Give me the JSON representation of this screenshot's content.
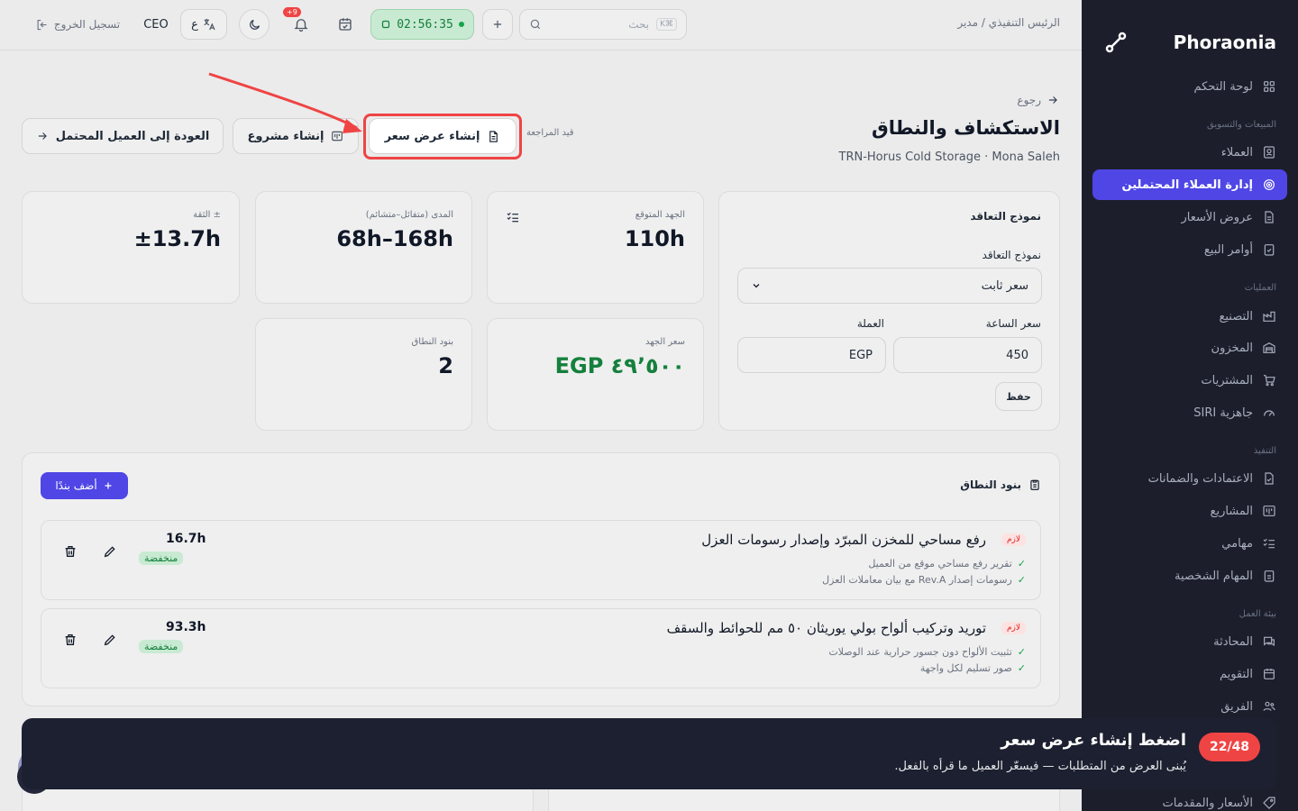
{
  "sidebar": {
    "brand": "Phoraonia",
    "sections": {
      "sales": "المبيعات والتسويق",
      "ops": "العمليات",
      "exec": "التنفيذ",
      "work": "بيئة العمل"
    },
    "items": [
      {
        "label": "لوحة التحكم",
        "icon": "grid-icon"
      },
      {
        "label": "العملاء",
        "icon": "contact-icon"
      },
      {
        "label": "إدارة العملاء المحتملين",
        "icon": "target-icon"
      },
      {
        "label": "عروض الأسعار",
        "icon": "file-icon"
      },
      {
        "label": "أوامر البيع",
        "icon": "clipboard-check-icon"
      },
      {
        "label": "التصنيع",
        "icon": "factory-icon"
      },
      {
        "label": "المخزون",
        "icon": "warehouse-icon"
      },
      {
        "label": "المشتريات",
        "icon": "cart-icon"
      },
      {
        "label": "جاهزية SIRI",
        "icon": "gauge-icon"
      },
      {
        "label": "الاعتمادات والضمانات",
        "icon": "file-check-icon"
      },
      {
        "label": "المشاريع",
        "icon": "kanban-icon"
      },
      {
        "label": "مهامي",
        "icon": "list-check-icon"
      },
      {
        "label": "المهام الشخصية",
        "icon": "clipboard-icon"
      },
      {
        "label": "المحادثة",
        "icon": "chat-icon"
      },
      {
        "label": "التقويم",
        "icon": "calendar-icon"
      },
      {
        "label": "الفريق",
        "icon": "users-icon"
      },
      {
        "label": "الأسعار والمقدمات",
        "icon": "tag-icon"
      }
    ]
  },
  "header": {
    "breadcrumb": "الرئيس التنفيذي / مدير",
    "search_placeholder": "بحث",
    "search_kbd": "K⌘",
    "timer": "02:56:35",
    "notif_count": "+9",
    "lang_label": "ع",
    "role": "CEO",
    "logout": "تسجيل الخروج"
  },
  "page": {
    "back": "رجوع",
    "title": "الاستكشاف والنطاق",
    "subtitle": "TRN-Horus Cold Storage · Mona Saleh",
    "status": "قيد المراجعة",
    "btn_quote": "إنشاء عرض سعر",
    "btn_project": "إنشاء مشروع",
    "btn_back_lead": "العودة إلى العميل المحتمل"
  },
  "contract": {
    "title": "نموذج التعاقد",
    "model_label": "نموذج التعاقد",
    "model_value": "سعر ثابت",
    "rate_label": "سعر الساعة",
    "rate_value": "450",
    "currency_label": "العملة",
    "currency_value": "EGP",
    "save": "حفظ"
  },
  "stats": {
    "effort_label": "الجهد المتوقع",
    "effort_value": "110h",
    "range_label": "المدى (متفائل–متشائم)",
    "range_value": "68h–168h",
    "conf_label": "± الثقة",
    "conf_value": "±13.7h",
    "price_label": "سعر الجهد",
    "price_value": "EGP ٤٩٬٥٠٠",
    "items_label": "بنود النطاق",
    "items_value": "2"
  },
  "scope": {
    "title": "بنود النطاق",
    "add": "أضف بندًا",
    "rows": [
      {
        "badge": "لازم",
        "title": "رفع مساحي للمخزن المبرّد وإصدار رسومات العزل",
        "deliverables": [
          "تقرير رفع مساحي موقع من العميل",
          "رسومات إصدار Rev.A مع بيان معاملات العزل"
        ],
        "hours": "16.7h",
        "risk": "منخفضة"
      },
      {
        "badge": "لازم",
        "title": "توريد وتركيب ألواح بولي يوريثان ٥٠ مم للحوائط والسقف",
        "deliverables": [
          "تثبيت الألواح دون جسور حرارية عند الوصلات",
          "صور تسليم لكل واجهة"
        ],
        "hours": "93.3h",
        "risk": "منخفضة"
      }
    ]
  },
  "tour": {
    "step": "22/48",
    "title": "اضغط إنشاء عرض سعر",
    "body": "يُبنى العرض من المتطلبات — فيسعّر العميل ما قرأه بالفعل."
  },
  "colors": {
    "accent": "#4f46e5",
    "danger": "#ef4444",
    "success": "#15803d",
    "sidebar": "#1c1f2b"
  }
}
